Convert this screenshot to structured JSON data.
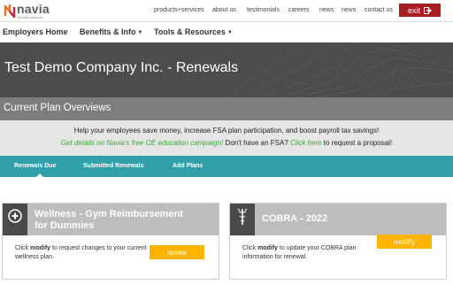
{
  "brand": {
    "name": "navia",
    "tagline": "benefit solutions",
    "accent": "#a41e22"
  },
  "topnav": {
    "items": [
      "products+services",
      "about us",
      "testimonials",
      "careers",
      "news",
      "news",
      "contact us"
    ],
    "exit_label": "exit"
  },
  "mainnav": {
    "items": [
      "Employers Home",
      "Benefits & Info",
      "Tools & Resources"
    ]
  },
  "hero": {
    "title": "Test Demo Company Inc. - Renewals"
  },
  "section": {
    "title": "Current Plan Overviews"
  },
  "promo": {
    "line1": "Help your employees save money, increase FSA plan participation, and boost payroll tax savings!",
    "link1": "Get details on Navia's free OE education campaign!",
    "text_mid": " Don't have an FSA? ",
    "link2": "Click here",
    "text_end": " to request a proposal!"
  },
  "tabs": [
    "Renewals Due",
    "Submitted Renewals",
    "Add Plans"
  ],
  "cards": [
    {
      "title_line1": "Wellness - Gym Reimbursement",
      "title_line2": "for Dummies",
      "text_pre": "Click ",
      "text_bold": "modify",
      "text_post": " to request changes to your current wellness plan.",
      "button": "renew",
      "icon": "plus-circle-icon"
    },
    {
      "title_line1": "COBRA - 2022",
      "text_pre": "Click ",
      "text_bold": "modify",
      "text_post": " to update your COBRA plan information for renewal.",
      "button": "modify",
      "icon": "caduceus-icon"
    }
  ],
  "colors": {
    "teal": "#2f9fa8",
    "hero_bg": "#4c4c4c",
    "band_bg": "#7d7d7d",
    "button": "#ffb400",
    "link": "#3aa53a"
  }
}
